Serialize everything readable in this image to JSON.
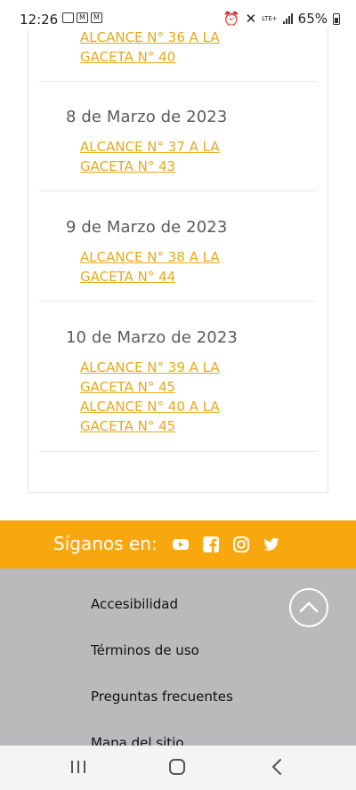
{
  "status_bar": {
    "time": "12:26",
    "battery": "65%",
    "network": "LTE+"
  },
  "entries": [
    {
      "date": "",
      "links": [
        "ALCANCE N° 36 A LA",
        "GACETA N° 40"
      ]
    },
    {
      "date": "8 de Marzo de 2023",
      "links": [
        "ALCANCE N° 37 A LA",
        "GACETA N° 43"
      ]
    },
    {
      "date": "9 de Marzo de 2023",
      "links": [
        "ALCANCE N° 38 A LA",
        "GACETA N° 44"
      ]
    },
    {
      "date": "10 de Marzo de 2023",
      "links": [
        "ALCANCE N° 39 A LA",
        "GACETA N° 45",
        "ALCANCE N° 40 A LA",
        "GACETA N° 45"
      ]
    }
  ],
  "follow": {
    "label": "Síganos en:",
    "icons": [
      "youtube-icon",
      "facebook-icon",
      "instagram-icon",
      "twitter-icon"
    ]
  },
  "footer": {
    "links": [
      "Accesibilidad",
      "Términos de uso",
      "Preguntas frecuentes",
      "Mapa del sitio"
    ]
  },
  "colors": {
    "link": "#e6a91a",
    "follow_bar": "#f8a80e",
    "footer": "#b9babc"
  }
}
